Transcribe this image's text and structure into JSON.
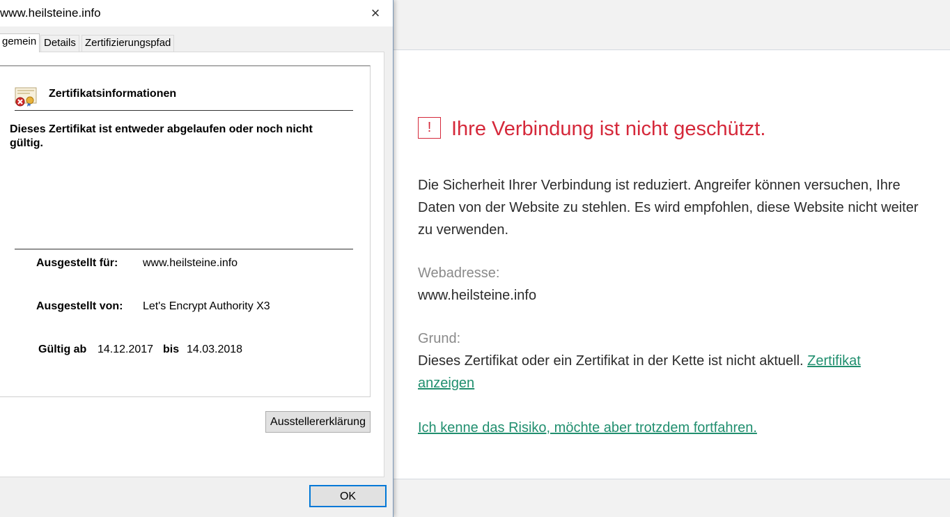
{
  "browser": {
    "warning_icon": "!",
    "title": "Ihre Verbindung ist nicht geschützt.",
    "description": "Die Sicherheit Ihrer Verbindung ist reduziert. Angreifer können versuchen, Ihre Daten von der Website zu stehlen. Es wird empfohlen, diese Website nicht weiter zu verwenden.",
    "address_label": "Webadresse:",
    "address_value": "www.heilsteine.info",
    "reason_label": "Grund:",
    "reason_text": "Dieses Zertifikat oder ein Zertifikat in der Kette ist nicht aktuell.",
    "view_cert_link": "Zertifikat anzeigen",
    "proceed_link": "Ich kenne das Risiko, möchte aber trotzdem fortfahren.",
    "colors": {
      "error": "#d5283a",
      "link": "#218f6f"
    }
  },
  "dialog": {
    "title": "www.heilsteine.info",
    "close_icon": "×",
    "tabs": [
      "gemein",
      "Details",
      "Zertifizierungspfad"
    ],
    "info_heading": "Zertifikatsinformationen",
    "info_message": "Dieses Zertifikat ist entweder abgelaufen oder noch nicht gültig.",
    "issued_to_label": "Ausgestellt für:",
    "issued_to_value": "www.heilsteine.info",
    "issued_by_label": "Ausgestellt von:",
    "issued_by_value": "Let's Encrypt Authority X3",
    "valid_from_label": "Gültig ab",
    "valid_from_value": "14.12.2017",
    "valid_to_label": "bis",
    "valid_to_value": "14.03.2018",
    "issuer_statement_button": "Ausstellererklärung",
    "ok_button": "OK"
  }
}
